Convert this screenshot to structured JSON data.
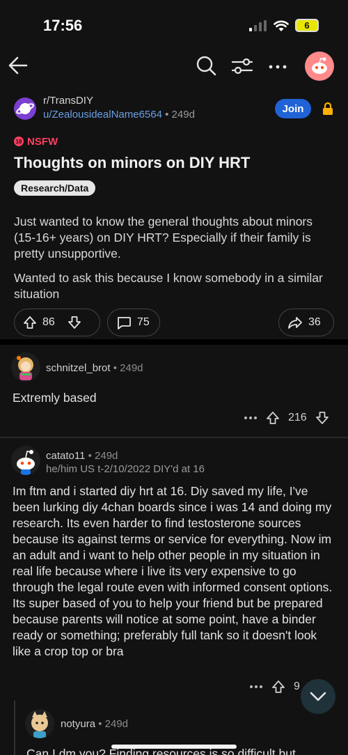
{
  "status_bar": {
    "time": "17:56",
    "battery": "6"
  },
  "post": {
    "subreddit": "r/TransDIY",
    "author": "u/ZealousidealName6564",
    "age": " • 249d",
    "join_label": "Join",
    "nsfw_label": "NSFW",
    "nsfw_icon_text": "18",
    "title": "Thoughts on minors on DIY HRT",
    "flair": "Research/Data",
    "body": [
      "Just wanted to know the general thoughts about minors (15-16+ years) on DIY HRT? Especially if their family is pretty unsupportive.",
      "Wanted to ask this because I know somebody in a similar situation"
    ],
    "upvotes": "86",
    "comments": "75",
    "shares": "36"
  },
  "comments": [
    {
      "user": "schnitzel_brot",
      "age": " • 249d",
      "body": "Extremly based",
      "score": "216"
    },
    {
      "user": "catato11",
      "age": " • 249d",
      "flair": "he/him US t-2/10/2022 DIY'd at 16",
      "body": "Im ftm and i started diy hrt at 16. Diy saved my life, I've been lurking diy 4chan boards since i was 14 and doing my research. Its even harder to find testosterone sources because its against terms or service for everything. Now im an adult and i want to help other people in my situation in real life because where i live its very expensive to go through the legal route even with informed consent options. Its super based of you to help your friend but be prepared because parents will notice at some point, have a binder ready or something; preferably full tank so it doesn't look like a crop top or bra",
      "score": "9"
    },
    {
      "user": "notyura",
      "age": " • 249d",
      "body": "Can I dm you? Finding resources is so difficult but"
    }
  ],
  "icons": {
    "back": "back-arrow-icon",
    "search": "search-icon",
    "filter": "filter-icon",
    "more": "more-icon",
    "lock": "lock-icon",
    "upvote": "upvote-icon",
    "downvote": "downvote-icon",
    "comment": "comment-icon",
    "share": "share-icon",
    "scroll": "chevron-down-icon"
  },
  "colors": {
    "background": "#121212",
    "accent_blue": "#1f63d6",
    "link_blue": "#6aa0e6",
    "nsfw_red": "#ff3f60",
    "lock_orange": "#ffb000"
  }
}
